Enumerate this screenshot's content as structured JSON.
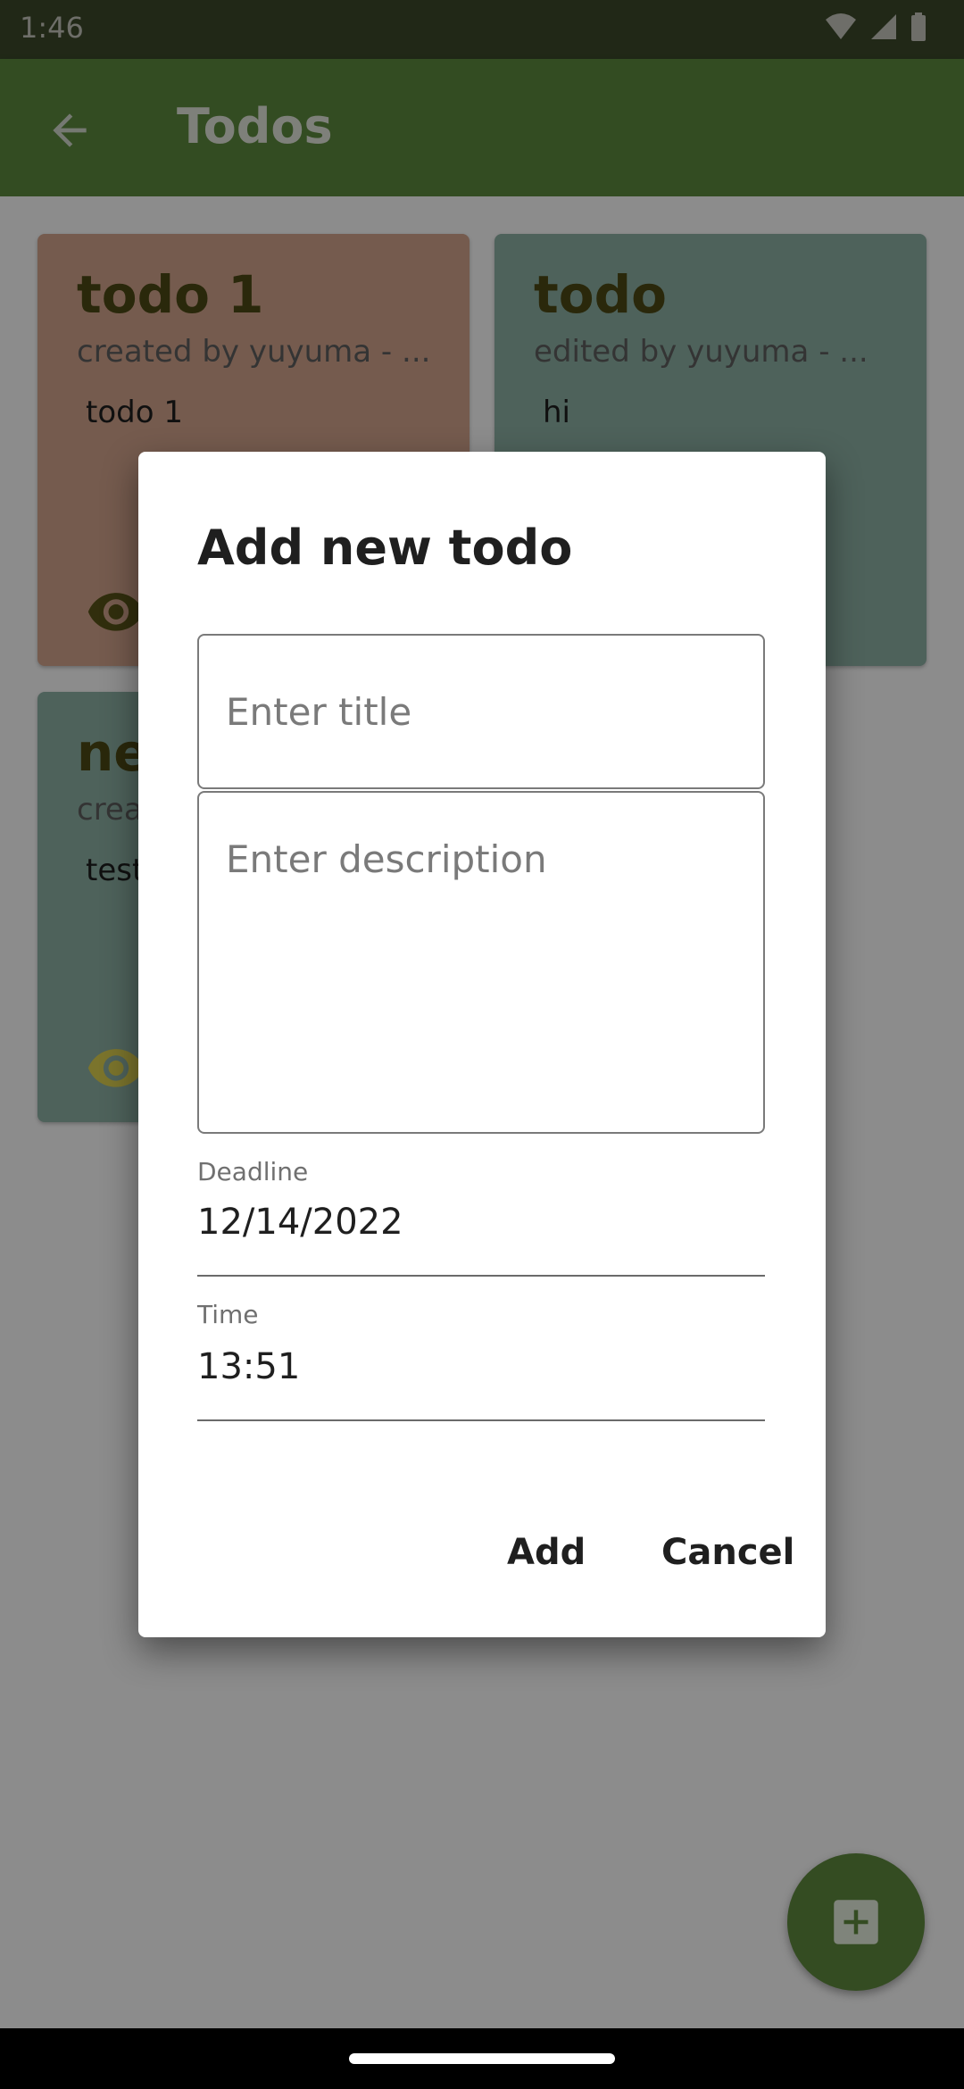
{
  "status_bar": {
    "time": "1:46",
    "icons": [
      "wifi-icon",
      "cell-signal-icon",
      "battery-icon"
    ]
  },
  "app_bar": {
    "title": "Todos",
    "back_icon": "arrow-left-icon"
  },
  "cards": [
    {
      "title": "todo 1",
      "subtitle": "created by yuyuma - ...",
      "description": "todo 1",
      "color": "#d5a78f"
    },
    {
      "title": "todo",
      "subtitle": "edited by yuyuma - ...",
      "description": "hi",
      "color": "#8fb3a7"
    },
    {
      "title": "ne",
      "subtitle": "crea",
      "description": "test",
      "color": "#8fb3a7"
    }
  ],
  "dialog": {
    "title": "Add new todo",
    "title_field": {
      "placeholder": "Enter title",
      "value": ""
    },
    "description_field": {
      "placeholder": "Enter description",
      "value": ""
    },
    "deadline": {
      "label": "Deadline",
      "value": "12/14/2022"
    },
    "time": {
      "label": "Time",
      "value": "13:51"
    },
    "add_label": "Add",
    "cancel_label": "Cancel"
  },
  "fab": {
    "icon": "add-square-icon"
  },
  "colors": {
    "app_bar": "#5e8a3f",
    "status_bar": "#3c4a2a",
    "card_title": "#4d4a14",
    "fab": "#5f8a3f"
  }
}
